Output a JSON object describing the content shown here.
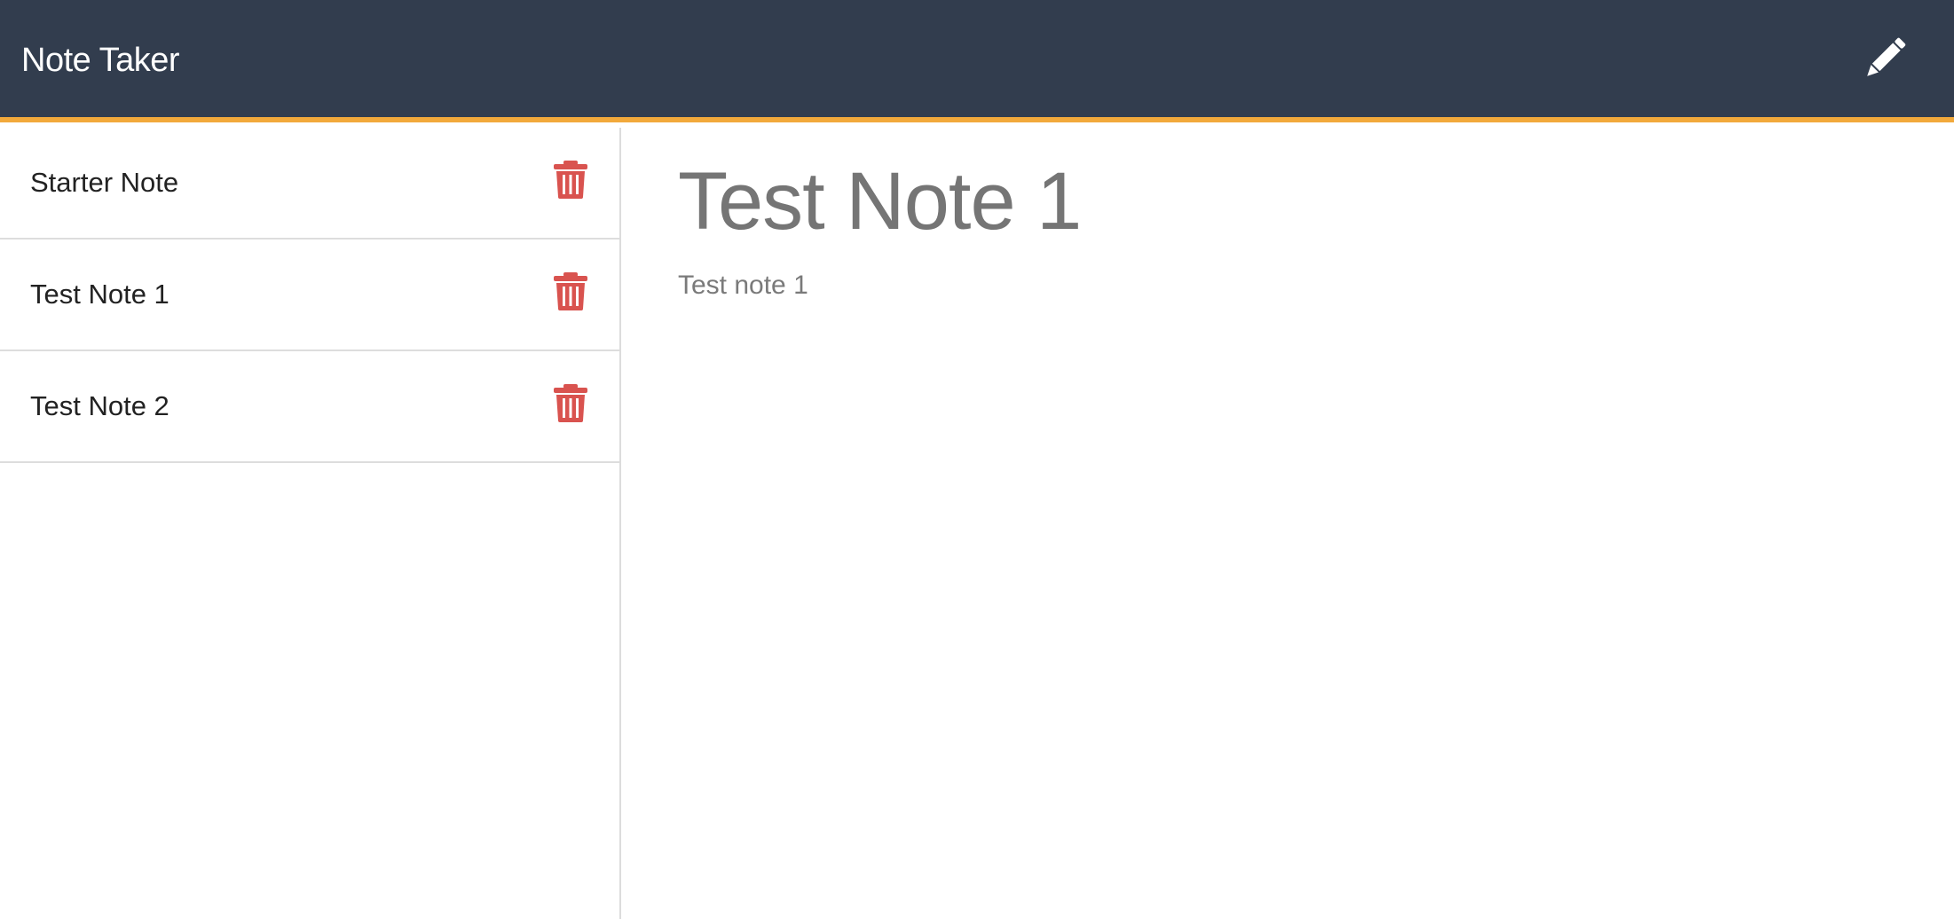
{
  "navbar": {
    "brand": "Note Taker",
    "new_note_icon": "pencil-icon",
    "background": "#323d4e",
    "accent": "#f2a93b"
  },
  "sidebar": {
    "notes": [
      {
        "title": "Starter Note",
        "delete_icon": "trash-icon"
      },
      {
        "title": "Test Note 1",
        "delete_icon": "trash-icon"
      },
      {
        "title": "Test Note 2",
        "delete_icon": "trash-icon"
      }
    ],
    "delete_color": "#d9534f"
  },
  "editor": {
    "title": "Test Note 1",
    "text": "Test note 1"
  }
}
